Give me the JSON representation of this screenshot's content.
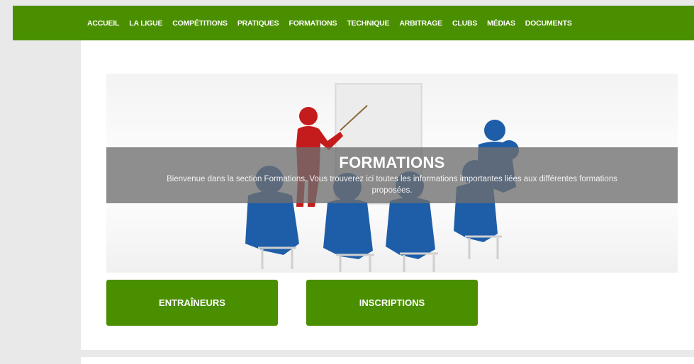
{
  "nav": {
    "items": [
      "ACCUEIL",
      "LA LIGUE",
      "COMPÉTITIONS",
      "PRATIQUES",
      "FORMATIONS",
      "TECHNIQUE",
      "ARBITRAGE",
      "CLUBS",
      "MÉDIAS",
      "DOCUMENTS"
    ]
  },
  "hero": {
    "title": "FORMATIONS",
    "text": "Bienvenue dans la section Formations. Vous trouverez ici toutes les informations importantes liées aux différentes formations proposées."
  },
  "buttons": {
    "trainers": "ENTRAÎNEURS",
    "registrations": "INSCRIPTIONS"
  },
  "colors": {
    "brand_green": "#4a8f00",
    "background": "#e9e9e9"
  }
}
